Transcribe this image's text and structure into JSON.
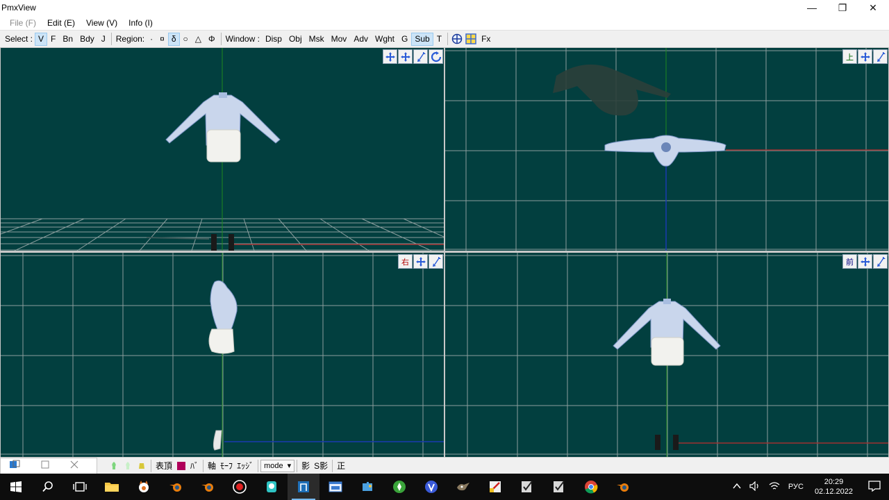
{
  "window": {
    "title": "PmxView",
    "minimize": "—",
    "restore": "❐",
    "close": "✕"
  },
  "menu": {
    "file": "File (F)",
    "edit": "Edit (E)",
    "view": "View (V)",
    "info": "Info (I)"
  },
  "toolbar": {
    "select_label": "Select :",
    "select_items": [
      "V",
      "F",
      "Bn",
      "Bdy",
      "J"
    ],
    "region_label": "Region:",
    "region_items": [
      "·",
      "¤",
      "δ",
      "○",
      "△",
      "Φ"
    ],
    "window_label": "Window :",
    "window_items": [
      "Disp",
      "Obj",
      "Msk",
      "Mov",
      "Adv",
      "Wght",
      "G",
      "Sub",
      "T"
    ],
    "fx_label": "Fx"
  },
  "viewports": {
    "top_right_label": "上",
    "bottom_left_label": "右",
    "bottom_right_label": "前"
  },
  "bottombar": {
    "pose_label": "表頂",
    "brush_label": "ﾊﾞ",
    "axis_label": "軸",
    "morph_label": "ﾓｰﾌ",
    "edge_label": "ｴｯｼﾞ",
    "mode_label": "mode",
    "shadow_label": "影",
    "sshadow_label": "S影",
    "ortho_label": "正"
  },
  "taskbar": {
    "lang": "РУС",
    "time": "20:29",
    "date": "02.12.2022"
  },
  "colors": {
    "viewport_bg": "#023f3f",
    "grid": "#8c9e9e",
    "accent": "#0078d7"
  }
}
